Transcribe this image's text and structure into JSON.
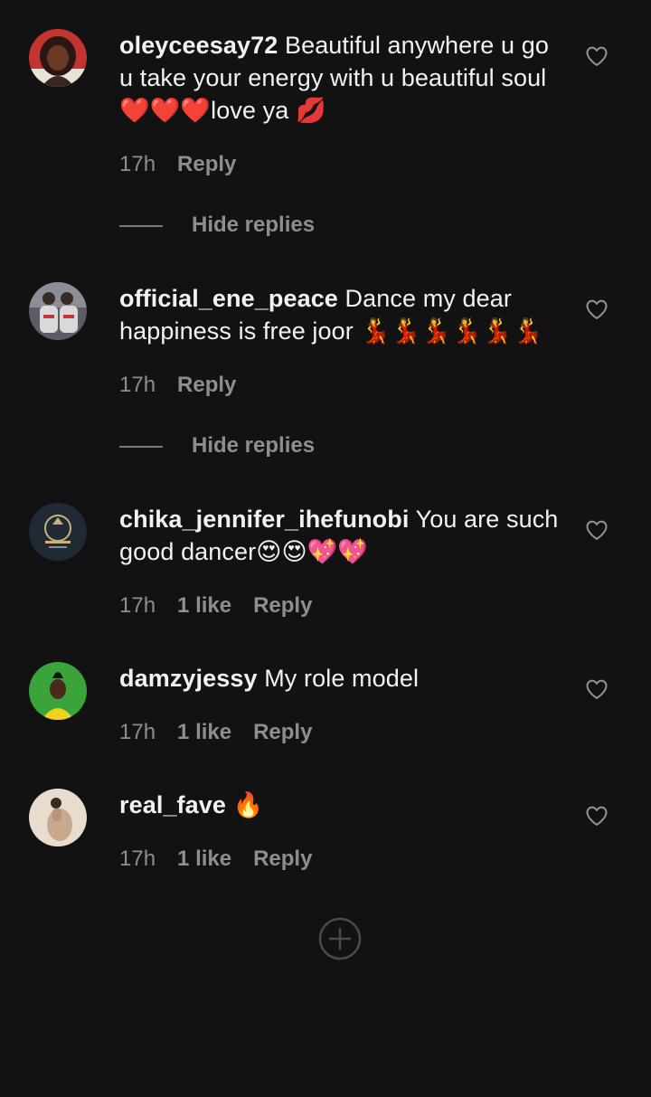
{
  "comments": [
    {
      "username": "oleyceesay72",
      "text": "Beautiful anywhere u go u take your energy with u beautiful soul ❤️❤️❤️love ya 💋",
      "time": "17h",
      "likes": "",
      "reply_label": "Reply",
      "avatar_color": "#c2342f"
    },
    {
      "username": "official_ene_peace",
      "text": "Dance my dear happiness is free joor 💃💃💃💃💃💃",
      "time": "17h",
      "likes": "",
      "reply_label": "Reply",
      "avatar_color": "#6d6f78"
    },
    {
      "username": "chika_jennifer_ihefunobi",
      "text": "You are such good dancer😍😍💖💖",
      "time": "17h",
      "likes": "1 like",
      "reply_label": "Reply",
      "avatar_color": "#1f2a35"
    },
    {
      "username": "damzyjessy",
      "text": "My role model",
      "time": "17h",
      "likes": "1 like",
      "reply_label": "Reply",
      "avatar_color": "#3aa33a"
    },
    {
      "username": "real_fave",
      "text": "🔥",
      "time": "17h",
      "likes": "1 like",
      "reply_label": "Reply",
      "avatar_color": "#c9a98e"
    }
  ],
  "hide_replies": [
    {
      "label": "Hide replies"
    },
    {
      "label": "Hide replies"
    }
  ],
  "colors": {
    "background": "#121212",
    "text": "#f2f2f2",
    "secondary": "#8e8e8e"
  },
  "icons": {
    "like": "heart-outline-icon",
    "load_more": "plus-circle-icon"
  }
}
